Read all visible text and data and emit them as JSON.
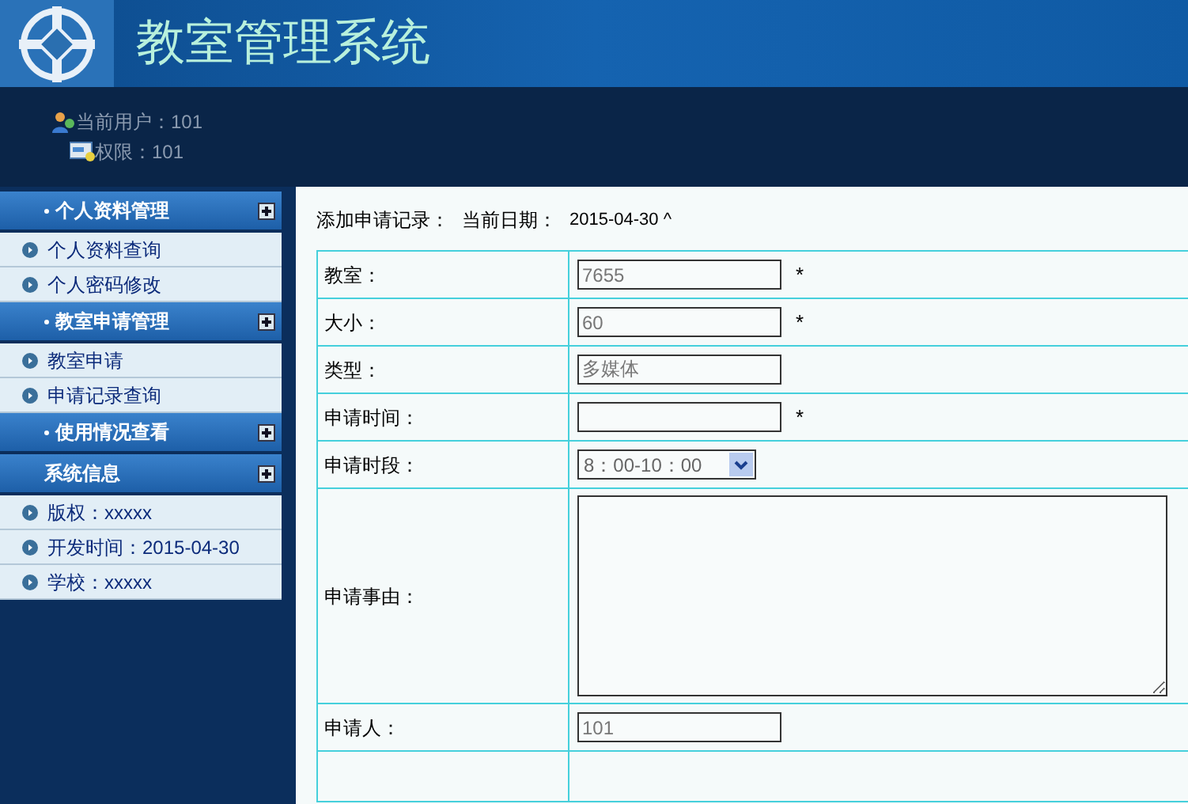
{
  "header": {
    "title": "教室管理系统"
  },
  "user_info": {
    "user": "当前用户：101",
    "permission": "权限：101"
  },
  "sidebar": {
    "sections": [
      {
        "title": "个人资料管理",
        "bullet": true,
        "items": [
          "个人资料查询",
          "个人密码修改"
        ]
      },
      {
        "title": "教室申请管理",
        "bullet": true,
        "items": [
          "教室申请",
          "申请记录查询"
        ]
      },
      {
        "title": "使用情况查看",
        "bullet": true
      },
      {
        "title": "系统信息",
        "bullet": false,
        "items": [
          "版权：xxxxx",
          "开发时间：2015-04-30",
          "学校：xxxxx"
        ]
      }
    ]
  },
  "form": {
    "heading": "添加申请记录：",
    "date_label": "当前日期：",
    "date": "2015-04-30 ^",
    "rows": [
      {
        "label": "教室：",
        "kind": "input",
        "value": "7655",
        "required": true
      },
      {
        "label": "大小：",
        "kind": "input",
        "value": "60",
        "required": true
      },
      {
        "label": "类型：",
        "kind": "input",
        "value": "多媒体",
        "required": false
      },
      {
        "label": "申请时间：",
        "kind": "input",
        "value": "",
        "required": true
      },
      {
        "label": "申请时段：",
        "kind": "select",
        "value": "8：00-10：00",
        "required": false
      },
      {
        "label": "申请事由：",
        "kind": "textarea",
        "value": "",
        "required": false
      },
      {
        "label": "申请人：",
        "kind": "input",
        "value": "101",
        "required": false
      },
      {
        "label": "",
        "kind": "empty",
        "value": "",
        "required": false
      }
    ],
    "required_mark": "*"
  }
}
